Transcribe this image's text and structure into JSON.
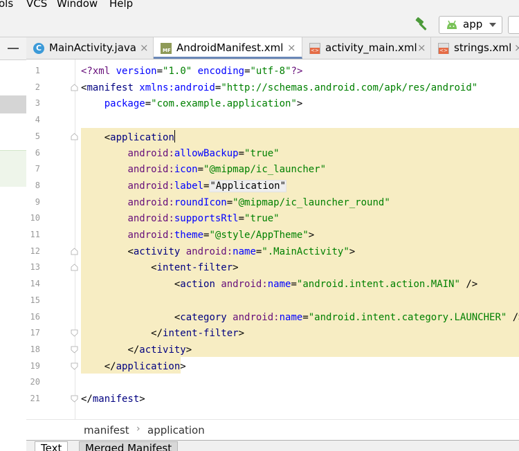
{
  "menu": [
    "ols",
    "VCS",
    "Window",
    "Help"
  ],
  "toolbar": {
    "run_config": "app",
    "icons": {
      "build": "hammer-icon",
      "run_config": "android-icon"
    }
  },
  "tabs": [
    {
      "label": "MainActivity.java",
      "icon": "java-class-icon",
      "active": false
    },
    {
      "label": "AndroidManifest.xml",
      "icon": "manifest-file-icon",
      "active": true
    },
    {
      "label": "activity_main.xml",
      "icon": "xml-file-icon",
      "active": false
    },
    {
      "label": "strings.xml",
      "icon": "xml-file-icon",
      "active": false
    }
  ],
  "tab_close_glyph": "×",
  "code_lines": [
    {
      "n": "1",
      "tokens": [
        [
          "<?xml ",
          "c-ns"
        ],
        [
          "version",
          "c-attr"
        ],
        [
          "=",
          "c-br"
        ],
        [
          "\"1.0\"",
          "c-val"
        ],
        [
          " ",
          "c-plain"
        ],
        [
          "encoding",
          "c-attr"
        ],
        [
          "=",
          "c-br"
        ],
        [
          "\"utf-8\"",
          "c-val"
        ],
        [
          "?>",
          "c-ns"
        ]
      ]
    },
    {
      "n": "2",
      "tokens": [
        [
          "<",
          "c-br"
        ],
        [
          "manifest ",
          "c-tag"
        ],
        [
          "xmlns:android",
          "c-attr"
        ],
        [
          "=",
          "c-br"
        ],
        [
          "\"http://schemas.android.com/apk/res/android\"",
          "c-val"
        ]
      ]
    },
    {
      "n": "3",
      "tokens": [
        [
          "    ",
          "c-plain"
        ],
        [
          "package",
          "c-attr"
        ],
        [
          "=",
          "c-br"
        ],
        [
          "\"com.example.application\"",
          "c-val"
        ],
        [
          ">",
          "c-br"
        ]
      ]
    },
    {
      "n": "4",
      "tokens": []
    },
    {
      "n": "5",
      "tokens": [
        [
          "    ",
          "c-plain"
        ],
        [
          "<",
          "c-br"
        ],
        [
          "application",
          "c-tag"
        ]
      ],
      "caret": true
    },
    {
      "n": "6",
      "tokens": [
        [
          "        ",
          "c-plain"
        ],
        [
          "android:",
          "c-ns"
        ],
        [
          "allowBackup",
          "c-attr"
        ],
        [
          "=",
          "c-br"
        ],
        [
          "\"true\"",
          "c-val"
        ]
      ]
    },
    {
      "n": "7",
      "tokens": [
        [
          "        ",
          "c-plain"
        ],
        [
          "android:",
          "c-ns"
        ],
        [
          "icon",
          "c-attr"
        ],
        [
          "=",
          "c-br"
        ],
        [
          "\"@mipmap/ic_launcher\"",
          "c-val"
        ]
      ]
    },
    {
      "n": "8",
      "tokens": [
        [
          "        ",
          "c-plain"
        ],
        [
          "android:",
          "c-ns"
        ],
        [
          "label",
          "c-attr"
        ],
        [
          "=",
          "c-br"
        ],
        [
          "\"Application\"",
          "c-plain label-folded"
        ]
      ]
    },
    {
      "n": "9",
      "tokens": [
        [
          "        ",
          "c-plain"
        ],
        [
          "android:",
          "c-ns"
        ],
        [
          "roundIcon",
          "c-attr"
        ],
        [
          "=",
          "c-br"
        ],
        [
          "\"@mipmap/ic_launcher_round\"",
          "c-val"
        ]
      ]
    },
    {
      "n": "10",
      "tokens": [
        [
          "        ",
          "c-plain"
        ],
        [
          "android:",
          "c-ns"
        ],
        [
          "supportsRtl",
          "c-attr"
        ],
        [
          "=",
          "c-br"
        ],
        [
          "\"true\"",
          "c-val"
        ]
      ]
    },
    {
      "n": "11",
      "tokens": [
        [
          "        ",
          "c-plain"
        ],
        [
          "android:",
          "c-ns"
        ],
        [
          "theme",
          "c-attr"
        ],
        [
          "=",
          "c-br"
        ],
        [
          "\"@style/AppTheme\"",
          "c-val"
        ],
        [
          ">",
          "c-br"
        ]
      ]
    },
    {
      "n": "12",
      "tokens": [
        [
          "        ",
          "c-plain"
        ],
        [
          "<",
          "c-br"
        ],
        [
          "activity ",
          "c-tag"
        ],
        [
          "android:",
          "c-ns"
        ],
        [
          "name",
          "c-attr"
        ],
        [
          "=",
          "c-br"
        ],
        [
          "\".MainActivity\"",
          "c-val"
        ],
        [
          ">",
          "c-br"
        ]
      ]
    },
    {
      "n": "13",
      "tokens": [
        [
          "            ",
          "c-plain"
        ],
        [
          "<",
          "c-br"
        ],
        [
          "intent-filter",
          "c-tag"
        ],
        [
          ">",
          "c-br"
        ]
      ]
    },
    {
      "n": "14",
      "tokens": [
        [
          "                ",
          "c-plain"
        ],
        [
          "<",
          "c-br"
        ],
        [
          "action ",
          "c-tag"
        ],
        [
          "android:",
          "c-ns"
        ],
        [
          "name",
          "c-attr"
        ],
        [
          "=",
          "c-br"
        ],
        [
          "\"android.intent.action.MAIN\"",
          "c-val"
        ],
        [
          " />",
          "c-br"
        ]
      ]
    },
    {
      "n": "15",
      "tokens": []
    },
    {
      "n": "16",
      "tokens": [
        [
          "                ",
          "c-plain"
        ],
        [
          "<",
          "c-br"
        ],
        [
          "category ",
          "c-tag"
        ],
        [
          "android:",
          "c-ns"
        ],
        [
          "name",
          "c-attr"
        ],
        [
          "=",
          "c-br"
        ],
        [
          "\"android.intent.category.LAUNCHER\"",
          "c-val"
        ],
        [
          " />",
          "c-br"
        ]
      ]
    },
    {
      "n": "17",
      "tokens": [
        [
          "            ",
          "c-plain"
        ],
        [
          "</",
          "c-br"
        ],
        [
          "intent-filter",
          "c-tag"
        ],
        [
          ">",
          "c-br"
        ]
      ]
    },
    {
      "n": "18",
      "tokens": [
        [
          "        ",
          "c-plain"
        ],
        [
          "</",
          "c-br"
        ],
        [
          "activity",
          "c-tag"
        ],
        [
          ">",
          "c-br"
        ]
      ]
    },
    {
      "n": "19",
      "tokens": [
        [
          "    ",
          "c-plain"
        ],
        [
          "</",
          "c-br"
        ],
        [
          "application",
          "c-tag"
        ],
        [
          ">",
          "c-br"
        ]
      ]
    },
    {
      "n": "20",
      "tokens": []
    },
    {
      "n": "21",
      "tokens": [
        [
          "</",
          "c-br"
        ],
        [
          "manifest",
          "c-tag"
        ],
        [
          ">",
          "c-br"
        ]
      ]
    }
  ],
  "fold_lines": [
    "2",
    "5",
    "12",
    "13",
    "17",
    "18",
    "19",
    "21"
  ],
  "breadcrumb": [
    "manifest",
    "application"
  ],
  "breadcrumb_sep": "›",
  "bottom_tabs": [
    "Text",
    "Merged Manifest"
  ],
  "colors": {
    "highlight": "#f7edc3",
    "active_tab_underline": "#6a88b8",
    "tag": "#000080",
    "attr": "#0000ff",
    "value": "#008000",
    "namespace": "#660e7a"
  }
}
